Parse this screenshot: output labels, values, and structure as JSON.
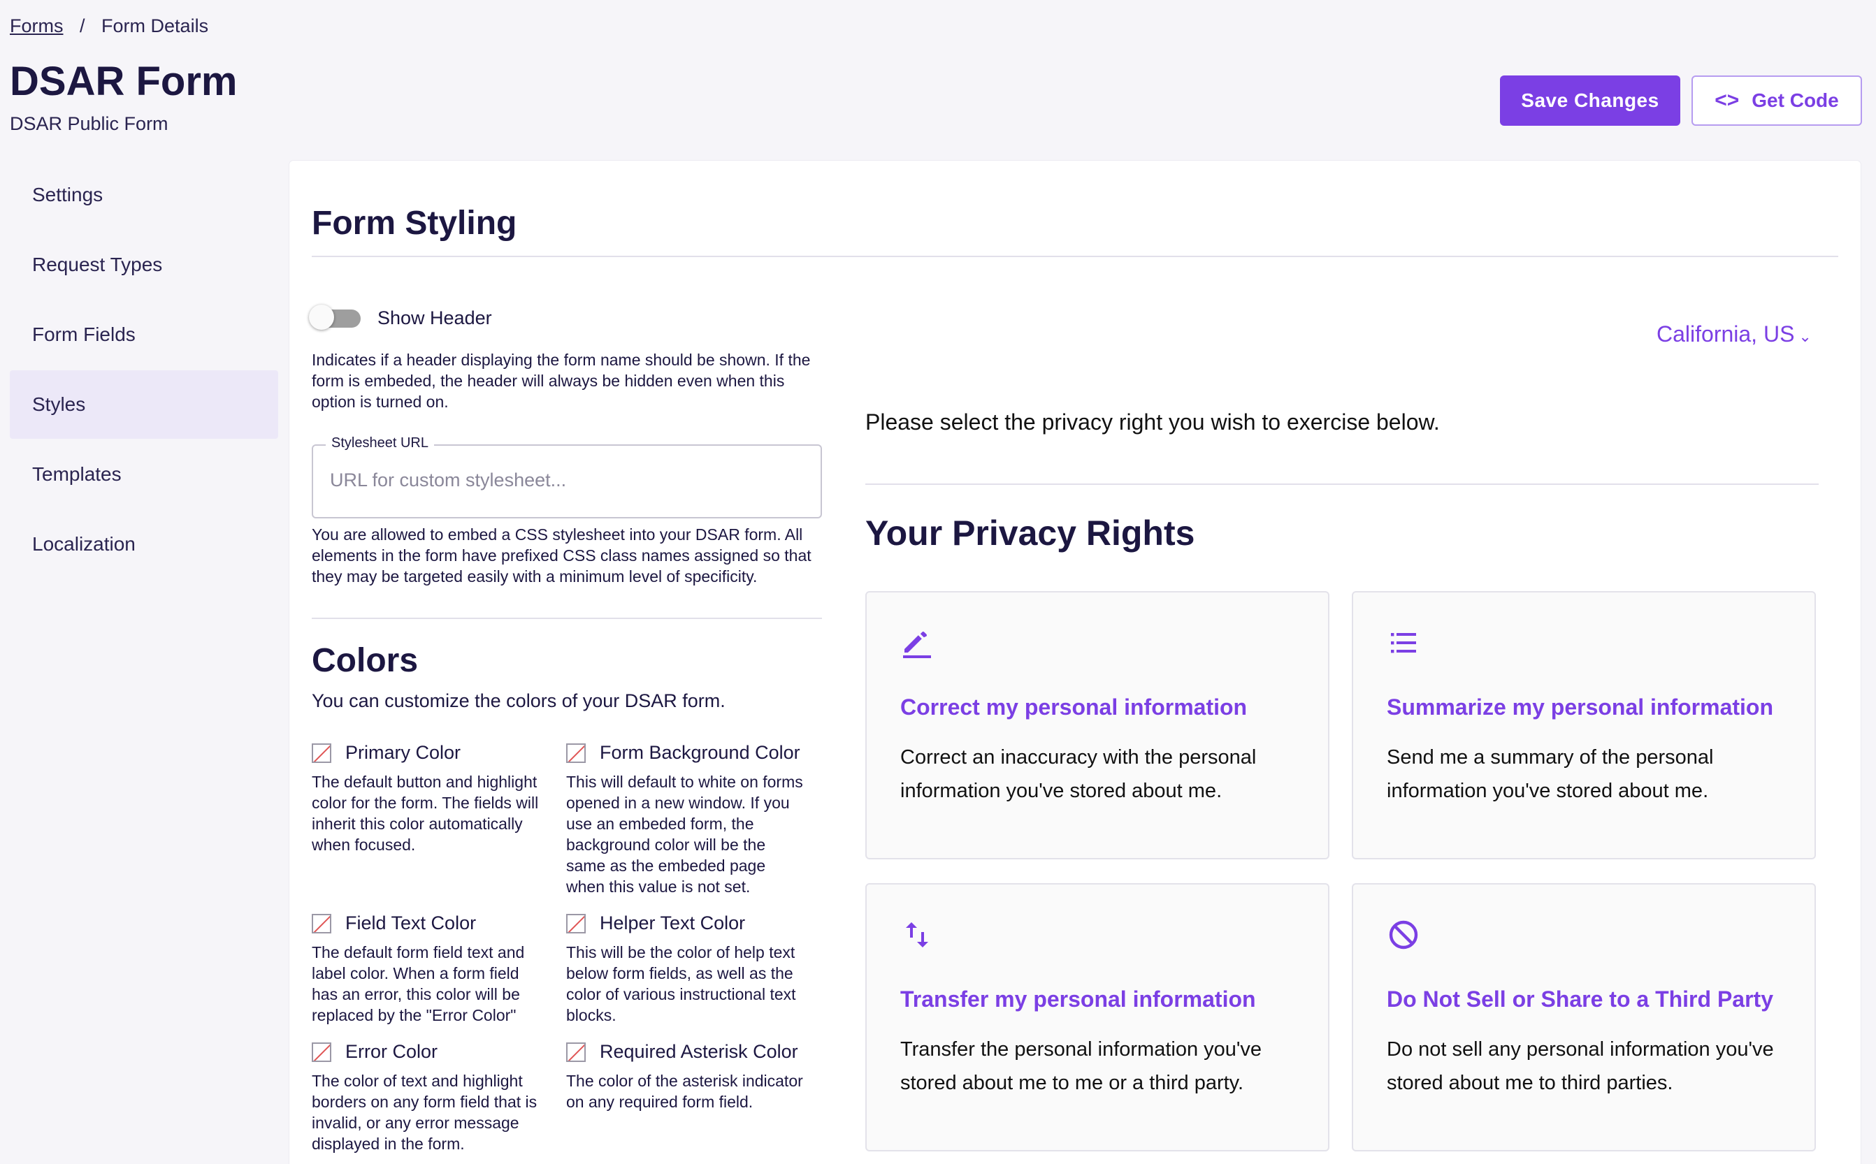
{
  "breadcrumb": {
    "root": "Forms",
    "separator": "/",
    "current": "Form Details"
  },
  "page": {
    "title": "DSAR Form",
    "subtitle": "DSAR Public Form"
  },
  "actions": {
    "save_label": "Save Changes",
    "code_symbol": "<>",
    "get_code_label": "Get Code"
  },
  "sidebar": {
    "items": [
      {
        "label": "Settings"
      },
      {
        "label": "Request Types"
      },
      {
        "label": "Form Fields"
      },
      {
        "label": "Styles",
        "active": true
      },
      {
        "label": "Templates"
      },
      {
        "label": "Localization"
      }
    ]
  },
  "styling": {
    "heading": "Form Styling",
    "show_header_label": "Show Header",
    "show_header_on": false,
    "show_header_help": "Indicates if a header displaying the form name should be shown. If the form is embeded, the header will always be hidden even when this option is turned on.",
    "stylesheet_label": "Stylesheet URL",
    "stylesheet_placeholder": "URL for custom stylesheet...",
    "stylesheet_value": "",
    "stylesheet_help": "You are allowed to embed a CSS stylesheet into your DSAR form. All elements in the form have prefixed CSS class names assigned so that they may be targeted easily with a minimum level of specificity."
  },
  "colors": {
    "heading": "Colors",
    "description": "You can customize the colors of your DSAR form.",
    "items": [
      {
        "label": "Primary Color",
        "help": "The default button and highlight color for the form. The fields will inherit this color automatically when focused."
      },
      {
        "label": "Form Background Color",
        "help": "This will default to white on forms opened in a new window. If you use an embeded form, the background color will be the same as the embeded page when this value is not set."
      },
      {
        "label": "Field Text Color",
        "help": "The default form field text and label color. When a form field has an error, this color will be replaced by the \"Error Color\""
      },
      {
        "label": "Helper Text Color",
        "help": "This will be the color of help text below form fields, as well as the color of various instructional text blocks."
      },
      {
        "label": "Error Color",
        "help": "The color of text and highlight borders on any form field that is invalid, or any error message displayed in the form."
      },
      {
        "label": "Required Asterisk Color",
        "help": "The color of the asterisk indicator on any required form field."
      }
    ]
  },
  "preview": {
    "region": "California, US",
    "prompt": "Please select the privacy right you wish to exercise below.",
    "heading": "Your Privacy Rights",
    "cards": [
      {
        "icon": "edit-icon",
        "title": "Correct my personal information",
        "desc": "Correct an inaccuracy with the personal information you've stored about me."
      },
      {
        "icon": "list-icon",
        "title": "Summarize my personal information",
        "desc": "Send me a summary of the personal information you've stored about me."
      },
      {
        "icon": "transfer-icon",
        "title": "Transfer my personal information",
        "desc": "Transfer the personal information you've stored about me to me or a third party."
      },
      {
        "icon": "block-icon",
        "title": "Do Not Sell or Share to a Third Party",
        "desc": "Do not sell any personal information you've stored about me to third parties."
      }
    ]
  },
  "theme": {
    "accent": "#7b3fe4",
    "text": "#1c1741",
    "background": "#f6f5f9",
    "active_nav": "#ece8f8"
  }
}
